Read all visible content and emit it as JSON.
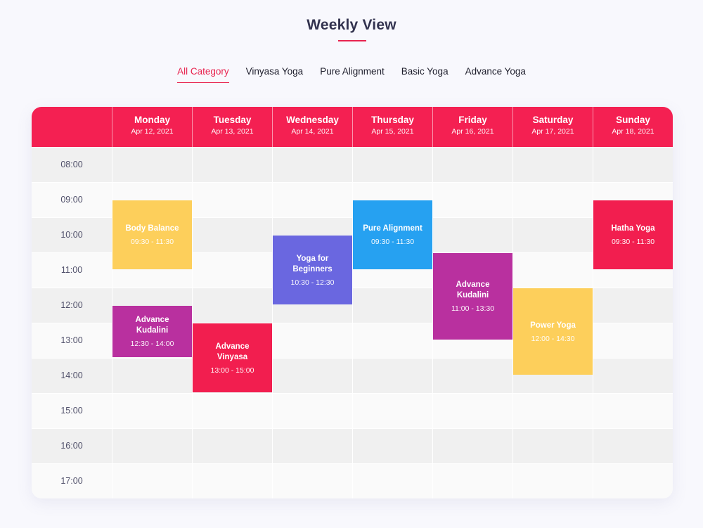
{
  "page": {
    "title": "Weekly View",
    "accent_color": "#e8234f"
  },
  "tabs": [
    {
      "label": "All Category",
      "active": true
    },
    {
      "label": "Vinyasa Yoga",
      "active": false
    },
    {
      "label": "Pure Alignment",
      "active": false
    },
    {
      "label": "Basic Yoga",
      "active": false
    },
    {
      "label": "Advance Yoga",
      "active": false
    }
  ],
  "days": [
    {
      "day": "Monday",
      "date": "Apr 12, 2021"
    },
    {
      "day": "Tuesday",
      "date": "Apr 13, 2021"
    },
    {
      "day": "Wednesday",
      "date": "Apr 14, 2021"
    },
    {
      "day": "Thursday",
      "date": "Apr 15, 2021"
    },
    {
      "day": "Friday",
      "date": "Apr 16, 2021"
    },
    {
      "day": "Saturday",
      "date": "Apr 17, 2021"
    },
    {
      "day": "Sunday",
      "date": "Apr 18, 2021"
    }
  ],
  "times": [
    "08:00",
    "09:00",
    "10:00",
    "11:00",
    "12:00",
    "13:00",
    "14:00",
    "15:00",
    "16:00",
    "17:00"
  ],
  "events": [
    {
      "name": "Body Balance",
      "time": "09:30 - 11:30",
      "day_index": 0,
      "start": 9.5,
      "end": 11.5,
      "color": "#fdcf5b"
    },
    {
      "name": "Advance Kudalini",
      "time": "12:30 - 14:00",
      "day_index": 0,
      "start": 12.5,
      "end": 14.0,
      "color": "#b9309f"
    },
    {
      "name": "Advance Vinyasa",
      "time": "13:00 - 15:00",
      "day_index": 1,
      "start": 13.0,
      "end": 15.0,
      "color": "#f21e4f"
    },
    {
      "name": "Yoga for Beginners",
      "time": "10:30 - 12:30",
      "day_index": 2,
      "start": 10.5,
      "end": 12.5,
      "color": "#6a67e0"
    },
    {
      "name": "Pure Alignment",
      "time": "09:30 - 11:30",
      "day_index": 3,
      "start": 9.5,
      "end": 11.5,
      "color": "#26a1f1"
    },
    {
      "name": "Advance Kudalini",
      "time": "11:00 - 13:30",
      "day_index": 4,
      "start": 11.0,
      "end": 13.5,
      "color": "#b9309f"
    },
    {
      "name": "Power Yoga",
      "time": "12:00 - 14:30",
      "day_index": 5,
      "start": 12.0,
      "end": 14.5,
      "color": "#fdcf5b"
    },
    {
      "name": "Hatha Yoga",
      "time": "09:30 - 11:30",
      "day_index": 6,
      "start": 9.5,
      "end": 11.5,
      "color": "#f21e4f"
    }
  ]
}
